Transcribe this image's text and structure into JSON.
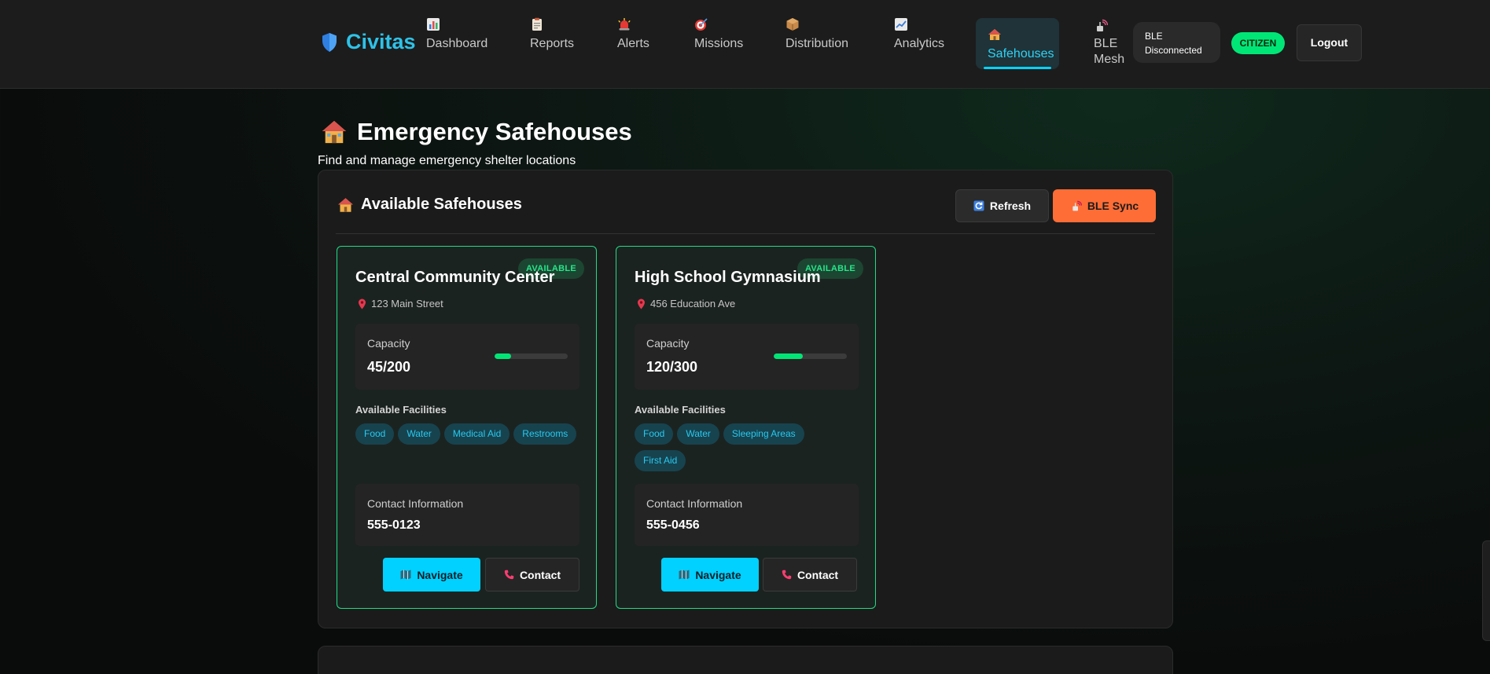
{
  "app": {
    "brand": "Civitas"
  },
  "nav": {
    "items": [
      {
        "id": "dashboard",
        "label": "Dashboard",
        "icon": "bar-chart-icon"
      },
      {
        "id": "reports",
        "label": "Reports",
        "icon": "clipboard-icon"
      },
      {
        "id": "alerts",
        "label": "Alerts",
        "icon": "siren-icon"
      },
      {
        "id": "missions",
        "label": "Missions",
        "icon": "target-icon"
      },
      {
        "id": "distribution",
        "label": "Distribution",
        "icon": "package-icon"
      },
      {
        "id": "analytics",
        "label": "Analytics",
        "icon": "line-chart-icon"
      },
      {
        "id": "safehouses",
        "label": "Safehouses",
        "icon": "house-icon",
        "active": true
      },
      {
        "id": "ble-mesh",
        "label_line1": "BLE",
        "label_line2": "Mesh",
        "icon": "antenna-icon"
      }
    ],
    "ble_status_line1": "BLE",
    "ble_status_line2": "Disconnected",
    "role": "CITIZEN",
    "logout_label": "Logout"
  },
  "page": {
    "title": "Emergency Safehouses",
    "subtitle": "Find and manage emergency shelter locations"
  },
  "panel": {
    "title": "Available Safehouses",
    "refresh_label": "Refresh",
    "ble_sync_label": "BLE Sync"
  },
  "safehouses": [
    {
      "name": "Central Community Center",
      "status": "AVAILABLE",
      "address": "123 Main Street",
      "capacity_label": "Capacity",
      "capacity": "45/200",
      "occupancy_fraction": 0.225,
      "facilities_label": "Available Facilities",
      "facilities": [
        "Food",
        "Water",
        "Medical Aid",
        "Restrooms"
      ],
      "contact_label": "Contact Information",
      "contact": "555-0123",
      "navigate_label": "Navigate",
      "contact_button_label": "Contact"
    },
    {
      "name": "High School Gymnasium",
      "status": "AVAILABLE",
      "address": "456 Education Ave",
      "capacity_label": "Capacity",
      "capacity": "120/300",
      "occupancy_fraction": 0.4,
      "facilities_label": "Available Facilities",
      "facilities": [
        "Food",
        "Water",
        "Sleeping Areas",
        "First Aid"
      ],
      "contact_label": "Contact Information",
      "contact": "555-0456",
      "navigate_label": "Navigate",
      "contact_button_label": "Contact"
    }
  ],
  "colors": {
    "accent": "#00d1ff",
    "success": "#00e676",
    "warning": "#ff6d36",
    "panel": "#1b1b1b"
  }
}
